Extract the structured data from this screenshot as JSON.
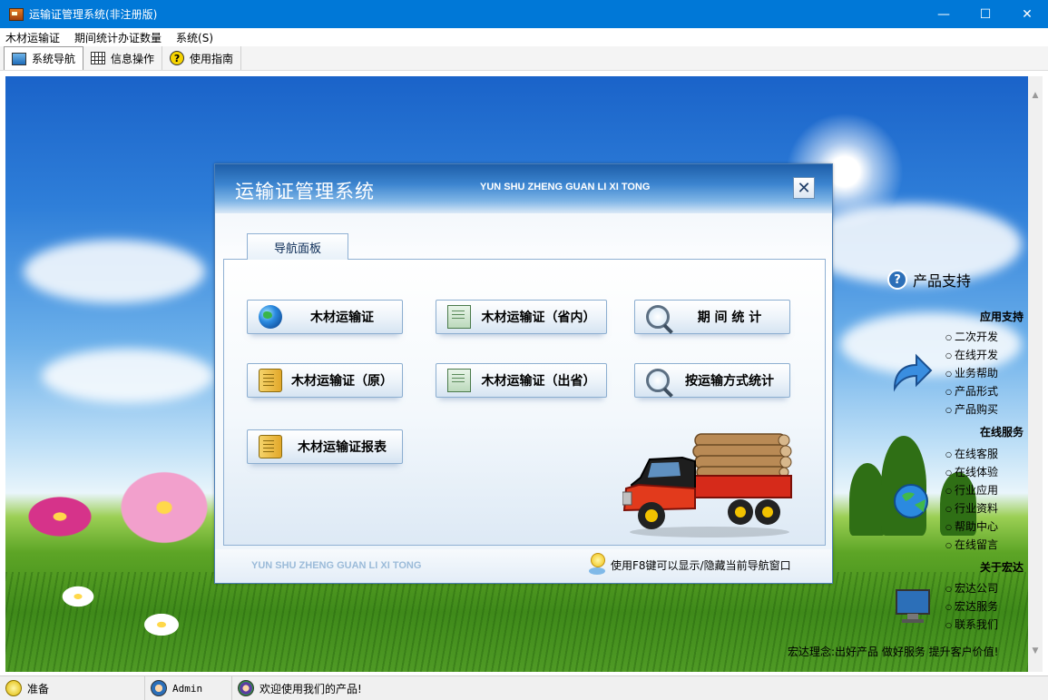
{
  "window": {
    "title": "运输证管理系统(非注册版)",
    "minimize_glyph": "—",
    "maximize_glyph": "☐",
    "close_glyph": "✕"
  },
  "menu": {
    "items": [
      "木材运输证",
      "期间统计办证数量",
      "系统(S)"
    ]
  },
  "toolbar": {
    "items": [
      {
        "label": "系统导航",
        "icon": "monitor-icon",
        "active": true
      },
      {
        "label": "信息操作",
        "icon": "grid-icon",
        "active": false
      },
      {
        "label": "使用指南",
        "icon": "help-icon",
        "active": false
      }
    ]
  },
  "dialog": {
    "title": "运输证管理系统",
    "subtitle": "YUN SHU ZHENG GUAN LI XI TONG",
    "close_glyph": "✕",
    "tab_label": "导航面板",
    "buttons": [
      {
        "label": "木材运输证",
        "icon": "globe-icon"
      },
      {
        "label": "木材运输证（省内）",
        "icon": "document-icon"
      },
      {
        "label": "期 间 统 计",
        "icon": "magnifier-icon"
      },
      {
        "label": "木材运输证（原）",
        "icon": "scroll-icon"
      },
      {
        "label": "木材运输证（出省）",
        "icon": "document-icon"
      },
      {
        "label": "按运输方式统计",
        "icon": "magnifier-icon"
      },
      {
        "label": "木材运输证报表",
        "icon": "scroll-icon"
      }
    ],
    "footer_left": "YUN SHU ZHENG GUAN LI XI TONG",
    "footer_tip": "使用F8键可以显示/隐藏当前导航窗口"
  },
  "right_panel": {
    "title": "产品支持",
    "sections": [
      {
        "heading": "应用支持",
        "items": [
          "二次开发",
          "在线开发",
          "业务帮助",
          "产品形式",
          "产品购买"
        ]
      },
      {
        "heading": "在线服务",
        "items": [
          "在线客服",
          "在线体验",
          "行业应用",
          "行业资料",
          "帮助中心",
          "在线留言"
        ]
      },
      {
        "heading": "关于宏达",
        "items": [
          "宏达公司",
          "宏达服务",
          "联系我们"
        ]
      }
    ],
    "slogan": "宏达理念:出好产品 做好服务 提升客户价值!"
  },
  "statusbar": {
    "status": "准备",
    "user": "Admin",
    "message": "欢迎使用我们的产品!"
  },
  "colors": {
    "titlebar": "#0078d7",
    "dialog_header": "#3b84cf",
    "button_border": "#8caed0"
  }
}
